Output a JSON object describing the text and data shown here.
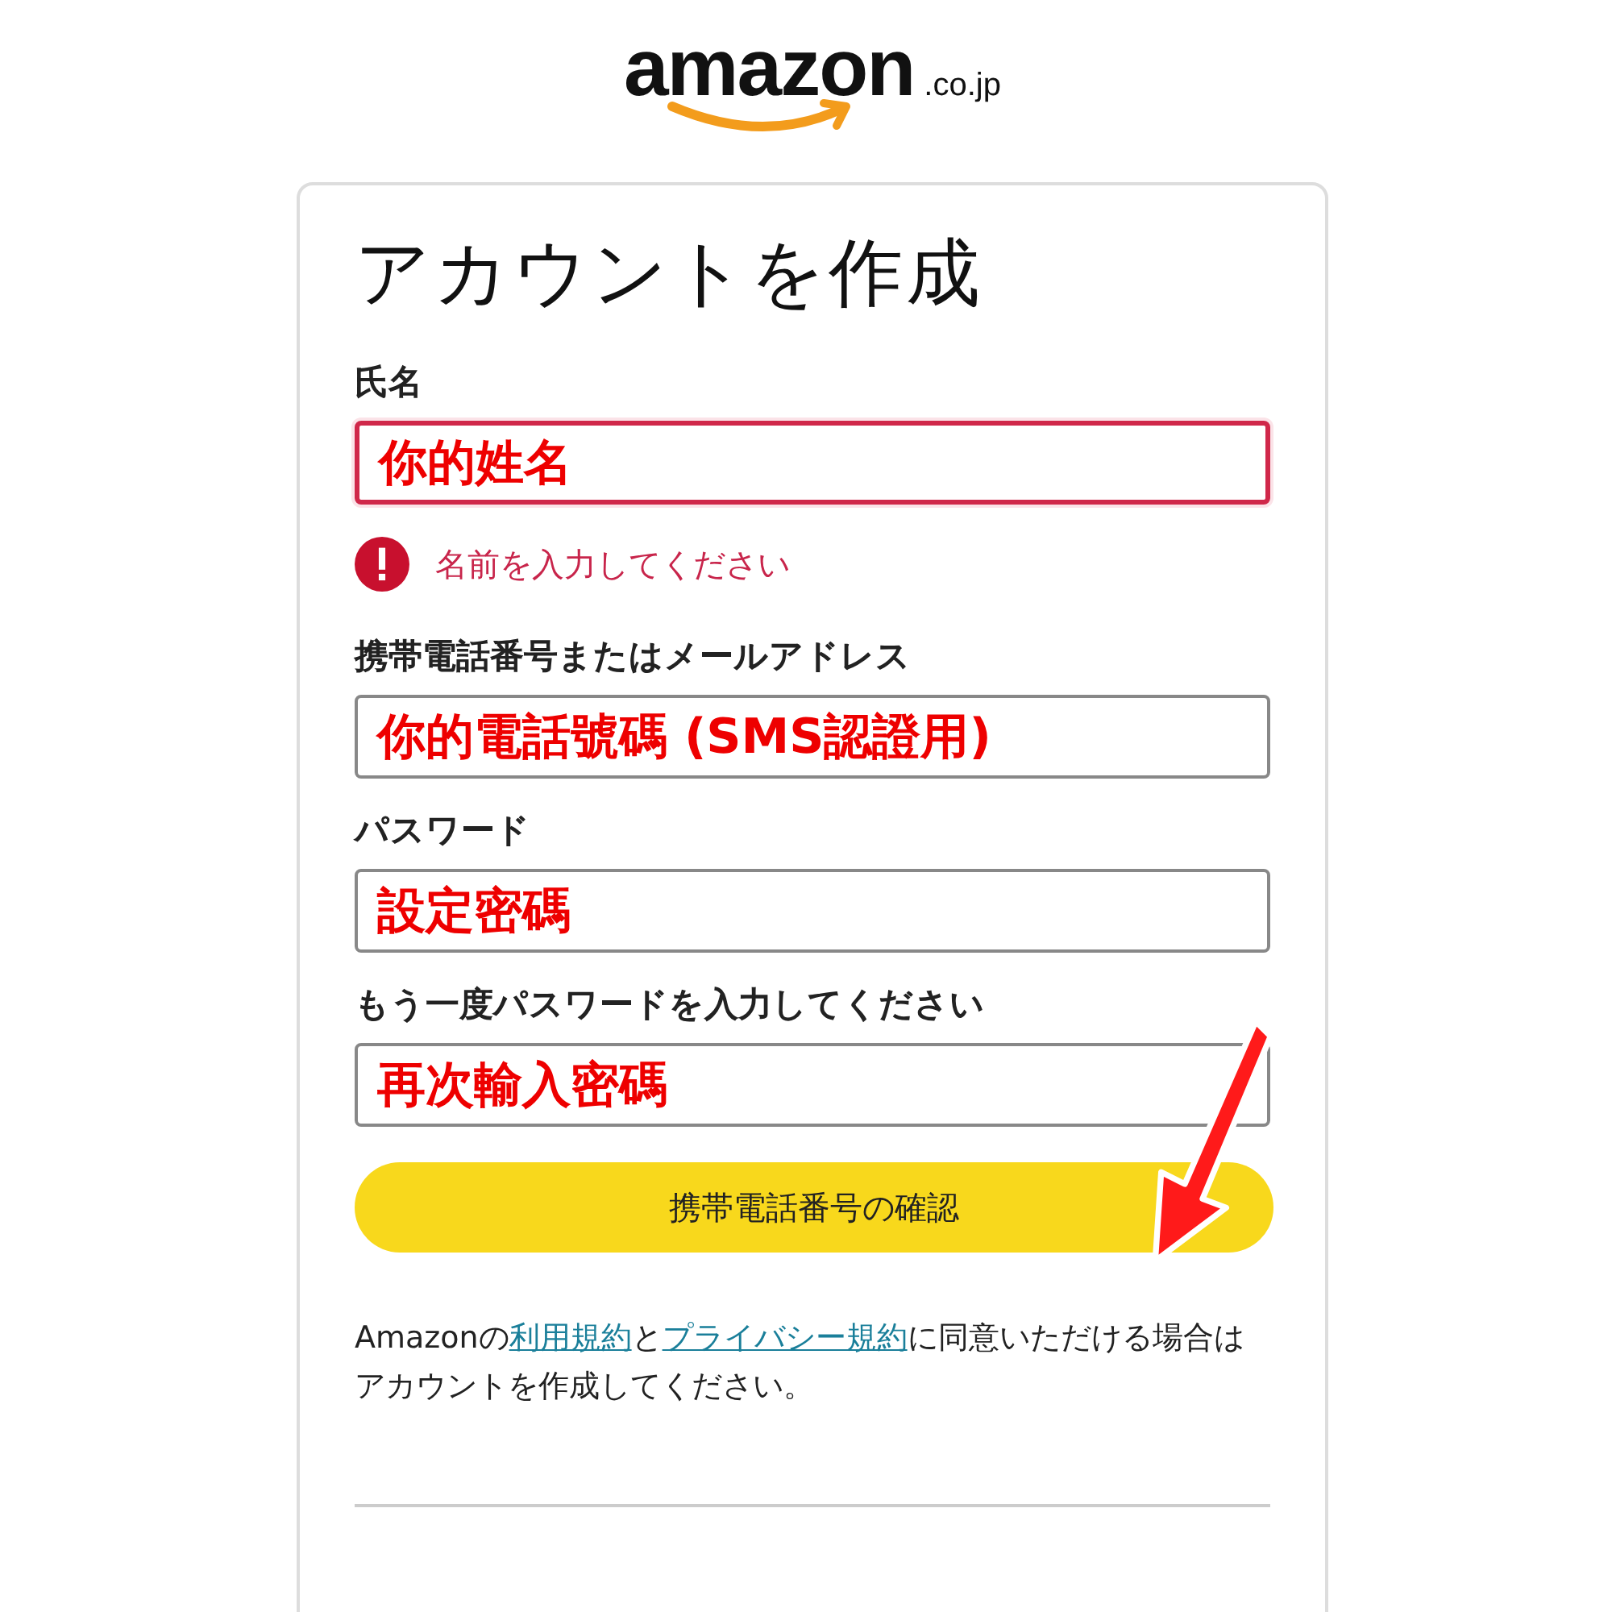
{
  "logo": {
    "name": "amazon",
    "suffix": ".co.jp"
  },
  "title": "アカウントを作成",
  "fields": [
    {
      "label": "氏名",
      "value": "你的姓名",
      "error": true,
      "error_message": "名前を入力してください"
    },
    {
      "label": "携帯電話番号またはメールアドレス",
      "value": "你的電話號碼 (SMS認證用)",
      "error": false
    },
    {
      "label": "パスワード",
      "value": "設定密碼",
      "error": false
    },
    {
      "label": "もう一度パスワードを入力してください",
      "value": "再次輸入密碼",
      "error": false
    }
  ],
  "submit_button": "携帯電話番号の確認",
  "consent": [
    {
      "kind": "text",
      "text": "Amazonの"
    },
    {
      "kind": "link",
      "text": "利用規約"
    },
    {
      "kind": "text",
      "text": "と"
    },
    {
      "kind": "link",
      "text": "プライバシー規約"
    },
    {
      "kind": "text",
      "text": "に同意いただける場合はアカウントを作成してください。"
    }
  ]
}
